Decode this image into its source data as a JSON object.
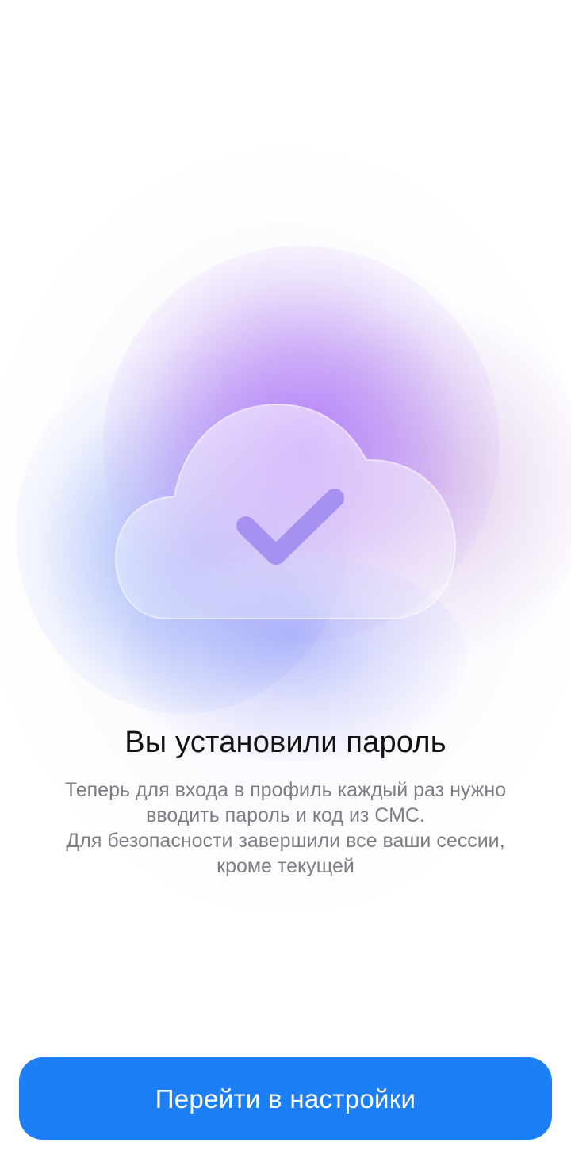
{
  "success_screen": {
    "illustration_icon": "cloud-check-icon",
    "title": "Вы установили пароль",
    "description_lines": [
      "Теперь для входа в профиль каждый раз нужно",
      "вводить пароль и код из СМС.",
      "Для безопасности завершили все ваши сессии,",
      "кроме текущей"
    ]
  },
  "actions": {
    "primary_label": "Перейти в настройки"
  },
  "colors": {
    "primary_button": "#1d7ff5",
    "title_text": "#111111",
    "description_text": "#7d7d84",
    "glow_purple": "#af78fa",
    "glow_blue": "#8296fa"
  }
}
